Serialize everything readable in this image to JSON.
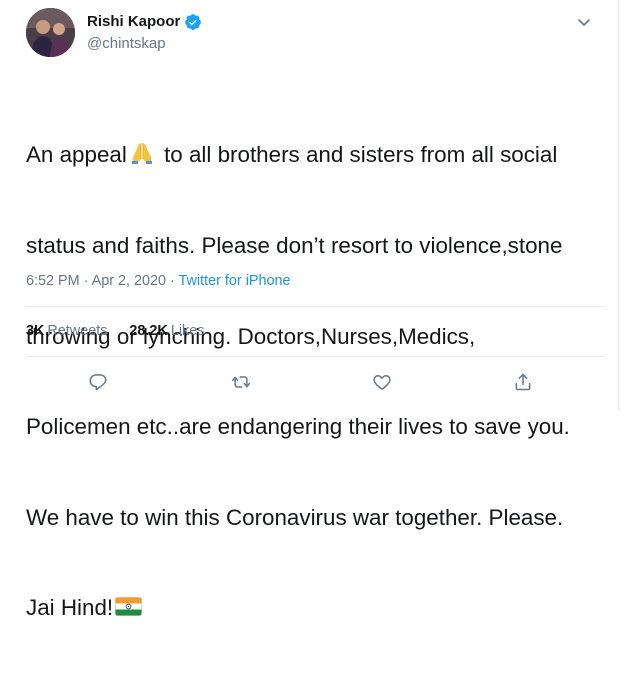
{
  "tweet": {
    "author": {
      "display_name": "Rishi Kapoor",
      "handle": "@chintskap",
      "verified": true
    },
    "text_lines": [
      "An appeal",
      " to all brothers and sisters from all social",
      "status and faiths. Please don’t resort to violence,stone",
      "throwing or lynching. Doctors,Nurses,Medics,",
      "Policemen etc..are endangering their lives to save you.",
      "We have to win this Coronavirus war together. Please.",
      "Jai Hind!"
    ],
    "meta": {
      "time": "6:52 PM",
      "separator1": " · ",
      "date": "Apr 2, 2020",
      "separator2": " · ",
      "source": "Twitter for iPhone"
    },
    "stats": {
      "retweets_count": "3K",
      "retweets_label": "Retweets",
      "likes_count": "28.2K",
      "likes_label": "Likes"
    },
    "icons": {
      "verified": "verified-badge-icon",
      "menu": "chevron-down-icon",
      "pray": "folded-hands-emoji",
      "flag": "india-flag-emoji",
      "reply": "reply-icon",
      "retweet": "retweet-icon",
      "like": "heart-icon",
      "share": "share-icon"
    },
    "colors": {
      "accent": "#1da1f2",
      "link": "#1b95e0",
      "secondary_text": "#657786",
      "icon": "#657786"
    }
  }
}
